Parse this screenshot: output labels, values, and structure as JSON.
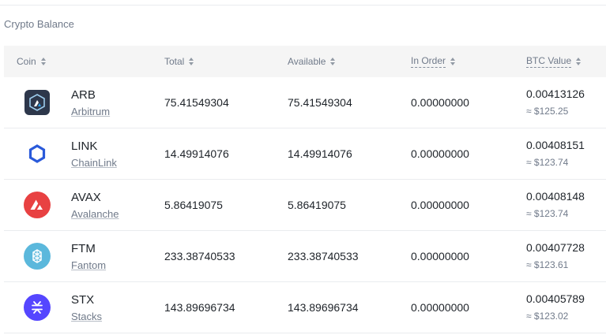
{
  "section": {
    "title": "Crypto Balance"
  },
  "table": {
    "headers": {
      "coin": "Coin",
      "total": "Total",
      "available": "Available",
      "in_order": "In Order",
      "btc_value": "BTC Value"
    },
    "rows": [
      {
        "symbol": "ARB",
        "name": "Arbitrum",
        "total": "75.41549304",
        "available": "75.41549304",
        "in_order": "0.00000000",
        "btc": "0.00413126",
        "usd": "≈ $125.25",
        "icon": "arbitrum-icon",
        "color": "#2d374b"
      },
      {
        "symbol": "LINK",
        "name": "ChainLink",
        "total": "14.49914076",
        "available": "14.49914076",
        "in_order": "0.00000000",
        "btc": "0.00408151",
        "usd": "≈ $123.74",
        "icon": "chainlink-icon",
        "color": "#2a5ada"
      },
      {
        "symbol": "AVAX",
        "name": "Avalanche",
        "total": "5.86419075",
        "available": "5.86419075",
        "in_order": "0.00000000",
        "btc": "0.00408148",
        "usd": "≈ $123.74",
        "icon": "avalanche-icon",
        "color": "#e84142"
      },
      {
        "symbol": "FTM",
        "name": "Fantom",
        "total": "233.38740533",
        "available": "233.38740533",
        "in_order": "0.00000000",
        "btc": "0.00407728",
        "usd": "≈ $123.61",
        "icon": "fantom-icon",
        "color": "#5bb8dc"
      },
      {
        "symbol": "STX",
        "name": "Stacks",
        "total": "143.89696734",
        "available": "143.89696734",
        "in_order": "0.00000000",
        "btc": "0.00405789",
        "usd": "≈ $123.02",
        "icon": "stacks-icon",
        "color": "#5546ff"
      }
    ]
  }
}
